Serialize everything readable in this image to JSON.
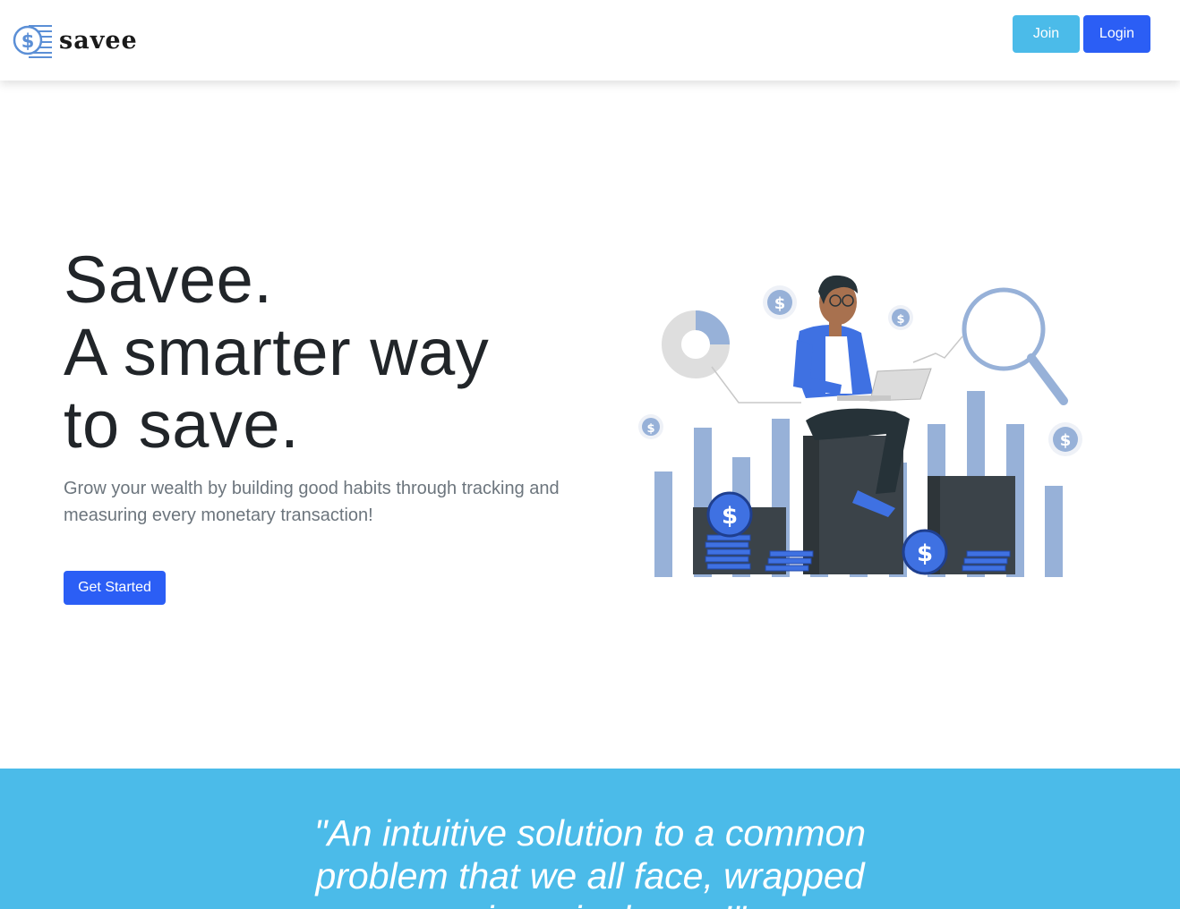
{
  "navbar": {
    "brand_name": "savee",
    "logo_icon": "dollar-coin-stack-icon",
    "join_label": "Join",
    "login_label": "Login"
  },
  "hero": {
    "title_lines": [
      "Savee.",
      "A smarter way",
      "to save."
    ],
    "subtitle": "Grow your wealth by building good habits through tracking and measuring every monetary transaction!",
    "cta_label": "Get Started",
    "illustration_icon": "person-on-bar-chart-with-coins-illustration"
  },
  "quote": {
    "lines": [
      "\"An intuitive solution to a common",
      "problem that we all face, wrapped",
      "up in a single app!\""
    ]
  },
  "colors": {
    "primary": "#2b5ef5",
    "accent": "#4bbbe9",
    "text": "#212529",
    "muted": "#6c757d"
  }
}
